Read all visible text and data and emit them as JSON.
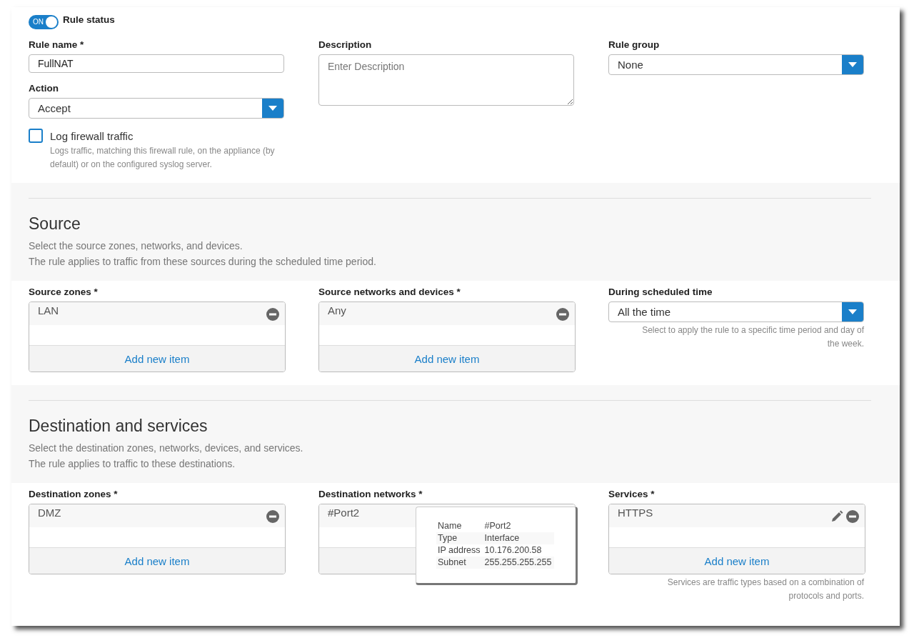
{
  "rule_status": {
    "label": "Rule status",
    "toggle_text": "ON",
    "on": true
  },
  "rule_name": {
    "label": "Rule name *",
    "value": "FullNAT"
  },
  "action": {
    "label": "Action",
    "value": "Accept"
  },
  "log_traffic": {
    "label": "Log firewall traffic",
    "checked": false,
    "help": "Logs traffic, matching this firewall rule, on the appliance (by default) or on the configured syslog server."
  },
  "description": {
    "label": "Description",
    "placeholder": "Enter Description"
  },
  "rule_group": {
    "label": "Rule group",
    "value": "None"
  },
  "sections": [
    {
      "title": "Source",
      "lines": [
        "Select the source zones, networks, and devices.",
        "The rule applies to traffic from these sources during the scheduled time period."
      ],
      "fields": [
        {
          "kind": "list",
          "label": "Source zones *",
          "items": [
            {
              "text": "LAN",
              "editable": false
            }
          ],
          "add_label": "Add new item"
        },
        {
          "kind": "list",
          "label": "Source networks and devices *",
          "items": [
            {
              "text": "Any",
              "editable": false
            }
          ],
          "add_label": "Add new item"
        },
        {
          "kind": "select",
          "label": "During scheduled time",
          "value": "All the time",
          "help": "Select to apply the rule to a specific time period and day of the week."
        }
      ]
    },
    {
      "title": "Destination and services",
      "lines": [
        "Select the destination zones, networks, devices, and services.",
        "The rule applies to traffic to these destinations."
      ],
      "fields": [
        {
          "kind": "list",
          "label": "Destination zones *",
          "items": [
            {
              "text": "DMZ",
              "editable": false
            }
          ],
          "add_label": "Add new item"
        },
        {
          "kind": "list",
          "label": "Destination networks *",
          "items": [
            {
              "text": "#Port2"
            }
          ],
          "tooltip": [
            {
              "name": "Name",
              "value": "#Port2"
            },
            {
              "name": "Type",
              "value": "Interface"
            },
            {
              "name": "IP address",
              "value": "10.176.200.58"
            },
            {
              "name": "Subnet",
              "value": "255.255.255.255"
            }
          ]
        },
        {
          "kind": "list",
          "label": "Services *",
          "items": [
            {
              "text": "HTTPS",
              "editable": true
            }
          ],
          "add_label": "Add new item",
          "help": "Services are traffic types based on a combination of protocols and ports."
        }
      ]
    }
  ]
}
